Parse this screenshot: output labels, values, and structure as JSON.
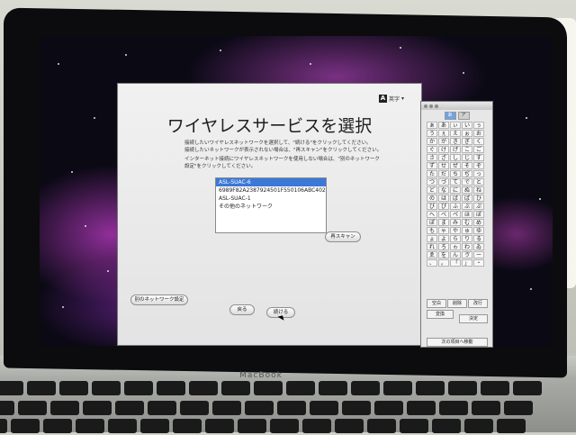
{
  "window": {
    "title": "ワイヤレスサービスを選択",
    "description1": [
      "接続したいワイヤレスネットワークを選択して、\"続ける\"をクリックしてください。",
      "接続したいネットワークが表示されない場合は、\"再スキャン\"をクリックしてください。"
    ],
    "description2": [
      "インターネット接続にワイヤレスネットワークを使用しない場合は、\"別のネットワーク",
      "設定\"をクリックしてください。"
    ],
    "networks": [
      "ASL-SUAC-6",
      "6989F82A2387924501F550106ABC4025",
      "ASL-SUAC-1",
      "その他のネットワーク"
    ],
    "selected_network_index": 0,
    "rescan_label": "再スキャン",
    "other_network_label": "別のネットワーク設定",
    "back_label": "戻る",
    "continue_label": "続ける",
    "ime_label": "英字",
    "ime_icon": "A"
  },
  "palette": {
    "tabs": [
      "あ",
      "ア"
    ],
    "characters": [
      "ぁ",
      "あ",
      "ぃ",
      "い",
      "ぅ",
      "う",
      "ぇ",
      "え",
      "ぉ",
      "お",
      "か",
      "が",
      "き",
      "ぎ",
      "く",
      "ぐ",
      "け",
      "げ",
      "こ",
      "ご",
      "さ",
      "ざ",
      "し",
      "じ",
      "す",
      "ず",
      "せ",
      "ぜ",
      "そ",
      "ぞ",
      "た",
      "だ",
      "ち",
      "ぢ",
      "っ",
      "つ",
      "づ",
      "て",
      "で",
      "と",
      "ど",
      "な",
      "に",
      "ぬ",
      "ね",
      "の",
      "は",
      "ば",
      "ぱ",
      "ひ",
      "び",
      "ぴ",
      "ふ",
      "ぶ",
      "ぷ",
      "へ",
      "べ",
      "ぺ",
      "ほ",
      "ぼ",
      "ぽ",
      "ま",
      "み",
      "む",
      "め",
      "も",
      "ゃ",
      "や",
      "ゅ",
      "ゆ",
      "ょ",
      "よ",
      "ら",
      "り",
      "る",
      "れ",
      "ろ",
      "ゎ",
      "わ",
      "ゐ",
      "ゑ",
      "を",
      "ん",
      "ゔ",
      "ー",
      "、",
      "。",
      "「",
      "」",
      "・"
    ],
    "space_label": "空白",
    "delete_label": "削除",
    "return_label": "改行",
    "convert_label": "変換",
    "confirm_label": "決定",
    "next_label": "次の項目へ移動"
  },
  "laptop": {
    "brand": "MacBook"
  }
}
